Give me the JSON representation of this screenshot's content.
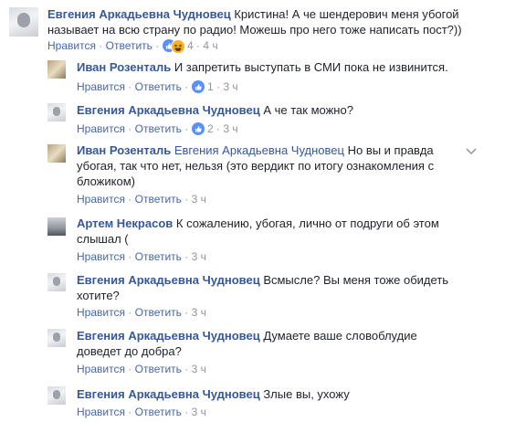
{
  "comments": [
    {
      "author": "Евгения Аркадьевна Чудновец",
      "mention": "",
      "line1": "Кристина! А че шендерович меня убогой",
      "line2": "называет на всю страну по радио! Можешь про него тоже написать пост?))",
      "like": "Нравится",
      "reply": "Ответить",
      "reactions": "4",
      "time": "4 ч"
    },
    {
      "author": "Иван Розенталь",
      "mention": "",
      "line1": "И запретить выступать в СМИ пока не извинится.",
      "like": "Нравится",
      "reply": "Ответить",
      "reactions": "1",
      "time": "3 ч"
    },
    {
      "author": "Евгения Аркадьевна Чудновец",
      "mention": "",
      "line1": "А че так можно?",
      "like": "Нравится",
      "reply": "Ответить",
      "reactions": "2",
      "time": "3 ч"
    },
    {
      "author": "Иван Розенталь",
      "mention": "Евгения Аркадьевна Чудновец",
      "line1": "Но вы и правда",
      "line2": "убогая, так что нет, нельзя (это вердикт по итогу ознакомления с",
      "line3": "бложиком)",
      "like": "Нравится",
      "reply": "Ответить",
      "time": "3 ч"
    },
    {
      "author": "Артем Некрасов",
      "line1": "К сожалению, убогая, лично от подруги об этом",
      "line2": "слышал (",
      "like": "Нравится",
      "reply": "Ответить",
      "time": "3 ч"
    },
    {
      "author": "Евгения Аркадьевна Чудновец",
      "line1": "Всмысле? Вы меня тоже обидеть",
      "line2": "хотите?",
      "like": "Нравится",
      "reply": "Ответить",
      "time": "3 ч"
    },
    {
      "author": "Евгения Аркадьевна Чудновец",
      "line1": "Думаете ваше словоблудие",
      "line2": "доведет до добра?",
      "like": "Нравится",
      "reply": "Ответить",
      "time": "3 ч"
    },
    {
      "author": "Евгения Аркадьевна Чудновец",
      "line1": "Злые вы, ухожу",
      "like": "Нравится",
      "reply": "Ответить",
      "time": "3 ч"
    }
  ],
  "separator": "·",
  "colors": {
    "link": "#365899",
    "action": "#4267b2",
    "meta": "#90949c",
    "like_reaction": "#5890ff",
    "haha_reaction": "#f7b125"
  },
  "icons": [
    "like-reaction-icon",
    "haha-reaction-icon",
    "chevron-down-icon",
    "avatar"
  ]
}
